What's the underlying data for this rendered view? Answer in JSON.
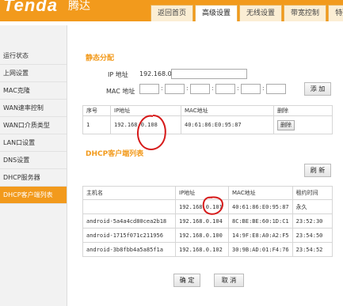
{
  "header": {
    "logo": "Tenda",
    "logo_cn": "腾达",
    "tabs": [
      {
        "label": "返回首页"
      },
      {
        "label": "高级设置"
      },
      {
        "label": "无线设置"
      },
      {
        "label": "带宽控制"
      },
      {
        "label": "特殊"
      }
    ]
  },
  "sidebar": {
    "items": [
      {
        "label": "运行状态"
      },
      {
        "label": "上网设置"
      },
      {
        "label": "MAC克隆"
      },
      {
        "label": "WAN速率控制"
      },
      {
        "label": "WAN口介质类型"
      },
      {
        "label": "LAN口设置"
      },
      {
        "label": "DNS设置"
      },
      {
        "label": "DHCP服务器"
      },
      {
        "label": "DHCP客户端列表"
      }
    ]
  },
  "static": {
    "title": "静态分配",
    "ip_label": "IP 地址",
    "ip_prefix": "192.168.0.",
    "mac_label": "MAC 地址",
    "mac_sep": ":",
    "add_label": "添 加",
    "table": {
      "headers": [
        "序号",
        "IP地址",
        "MAC地址",
        "删除"
      ],
      "rows": [
        {
          "no": "1",
          "ip": "192.168.0.108",
          "mac": "40:61:86:E0:95:87",
          "del": "删除"
        }
      ]
    }
  },
  "dhcp": {
    "title": "DHCP客户端列表",
    "refresh_label": "刷 新",
    "table": {
      "headers": [
        "主机名",
        "IP地址",
        "MAC地址",
        "租约时间"
      ],
      "rows": [
        {
          "host": "",
          "ip": "192.168.0.101",
          "mac": "40:61:86:E0:95:87",
          "lease": "永久"
        },
        {
          "host": "android-5a4a4cd80cea2b18",
          "ip": "192.168.0.104",
          "mac": "8C:BE:BE:60:1D:C1",
          "lease": "23:52:30"
        },
        {
          "host": "android-1715f071c211956",
          "ip": "192.168.0.100",
          "mac": "14:9F:E8:A0:A2:F5",
          "lease": "23:54:50"
        },
        {
          "host": "android-3b8fbb4a5a85f1a",
          "ip": "192.168.0.102",
          "mac": "30:9B:AD:01:F4:76",
          "lease": "23:54:52"
        }
      ]
    }
  },
  "footer": {
    "ok_label": "确 定",
    "cancel_label": "取 消"
  },
  "colors": {
    "brand": "#f29a1c",
    "annotation": "#d61b1b"
  }
}
